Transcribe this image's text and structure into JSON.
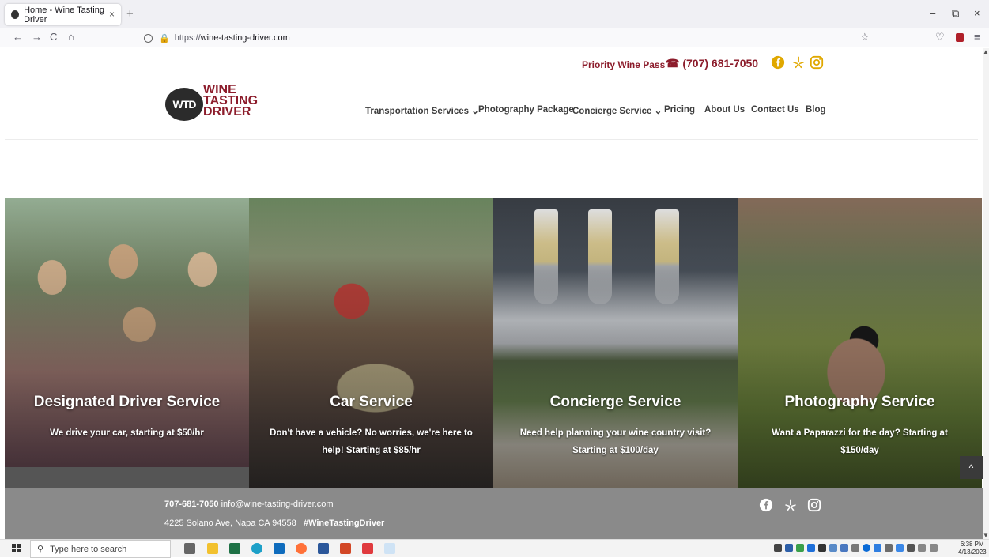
{
  "browser": {
    "tab_title": "Home - Wine Tasting Driver",
    "tab_close": "×",
    "new_tab": "+",
    "url_prefix": "https://",
    "url_host": "wine-tasting-driver.com",
    "controls": {
      "minimize": "–",
      "restore": "⧉",
      "close": "×"
    },
    "nav": {
      "back": "←",
      "forward": "→",
      "reload": "C",
      "home": "⌂",
      "star": "☆",
      "pocket": "♡",
      "menu": "≡"
    }
  },
  "header": {
    "priority_link": "Priority Wine Pass",
    "phone": "(707) 681-7050",
    "phone_icon": "☎",
    "logo": {
      "badge": "WTD",
      "line1": "WINE",
      "line2": "TASTING",
      "line3": "DRIVER"
    },
    "menu": [
      {
        "label": "Transportation Services",
        "caret": "⌄"
      },
      {
        "label": "Photography Package"
      },
      {
        "label": "Concierge Service",
        "caret": "⌄"
      },
      {
        "label": "Pricing"
      },
      {
        "label": "About Us"
      },
      {
        "label": "Contact Us"
      },
      {
        "label": "Blog"
      }
    ],
    "social_color": "#e0a800"
  },
  "services": [
    {
      "title": "Designated Driver Service",
      "text": "We drive your car, starting at $50/hr"
    },
    {
      "title": "Car Service",
      "text": "Don't have a vehicle? No worries, we're here to help! Starting at $85/hr"
    },
    {
      "title": "Concierge Service",
      "text": "Need help planning your wine country visit? Starting at $100/day"
    },
    {
      "title": "Photography Service",
      "text": "Want a Paparazzi for the day? Starting at $150/day"
    }
  ],
  "scroll_top": "^",
  "footer": {
    "phone": "707-681-7050",
    "email": "info@wine-tasting-driver.com",
    "address": "4225 Solano Ave, Napa CA 94558",
    "hashtag": "#WineTastingDriver"
  },
  "taskbar": {
    "search_placeholder": "Type here to search",
    "search_icon": "⚲",
    "time": "6:38 PM",
    "date": "4/13/2023"
  },
  "colors": {
    "brand": "#8c1c2b",
    "footer": "#8a8a8a"
  }
}
